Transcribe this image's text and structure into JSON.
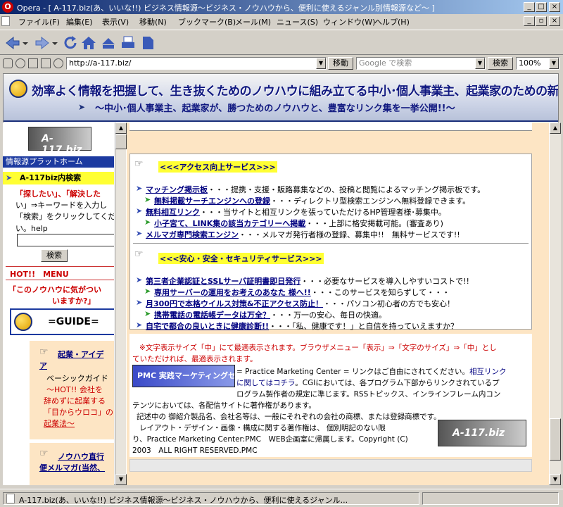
{
  "window": {
    "title": "Opera - [ A-117.biz(あ、いいな!!) ビジネス情報源〜ビジネス・ノウハウから、便利に使えるジャンル別情報源など〜 ]",
    "minimize": "_",
    "maximize": "□",
    "close": "×"
  },
  "menu": [
    "ファイル(F)",
    "編集(E)",
    "表示(V)",
    "移動(N)",
    "ブックマーク(B)",
    "メール(M)",
    "ニュース(S)",
    "ウィンドウ(W)",
    "ヘルプ(H)"
  ],
  "toolbar": {
    "icons": [
      "back-icon",
      "forward-icon",
      "reload-icon",
      "home-icon",
      "hotlist-icon",
      "print-icon",
      "page-icon"
    ]
  },
  "address": {
    "url": "http://a-117.biz/",
    "go_label": "移動",
    "search_placeholder": "Google で検索",
    "search_label": "検索",
    "zoom": "100%"
  },
  "banner": {
    "title": "効率よく情報を把握して、生き抜くためのノウハウに組み立てる中小･個人事業主、起業家のための新･情報入手ガイド",
    "subtitle": "〜中小･個人事業主、起業家が、勝つためのノウハウと、豊富なリンク集を一挙公開!!〜"
  },
  "left": {
    "logo": "A-117.biz",
    "platform": "情報源プラットホーム",
    "search_title": "A-117biz内検索",
    "search_text1": "「探したい」、「解決した",
    "search_text2": "い」⇒キーワードを入力し",
    "search_text3": "「検索」をクリックしてくだ",
    "search_example": "い。help",
    "search_button": "検索",
    "hot_menu": "HOT!!　MENU",
    "notice1": "「このノウハウに気がつい",
    "notice2": "いますか?」",
    "guide": "=GUIDE=",
    "item1_title": "起業・アイデ",
    "item1_title2": "ア",
    "item1_l1": "ベーシックガイド",
    "item1_l2": "〜HOT!! 会社を",
    "item1_l3": "辞めずに起業する",
    "item1_l4": "「目からウロコ」の",
    "item1_l5": "起業法〜",
    "item2_title": "ノウハウ直行",
    "item2_l1": "便メルマガ(当然、"
  },
  "main": {
    "section1_title": "<<<アクセス向上サービス>>>",
    "s1": [
      {
        "link": "マッチング掲示板",
        "desc": "・・・提携・支援・販路募集などの、投稿と閲覧によるマッチング掲示板です。"
      },
      {
        "link": "無料掲載サーチエンジンへの登録",
        "desc": "・・・ディレクトリ型検索エンジンへ無料登録できます。"
      },
      {
        "link": "無料相互リンク",
        "desc": "・・・当サイトと相互リンクを張っていただけるHP管理者様･募集中。"
      },
      {
        "link": "小子宮て、LINK集の該当カテゴリーへ掲載",
        "desc": "・・・上部に格安掲載可能。(審査あり)"
      },
      {
        "link": "メルマガ専門検索エンジン",
        "desc": "・・・メルマガ発行者様の登録、募集中!!　無料サービスです!!"
      }
    ],
    "section2_title": "<<<安心・安全・セキュリティサービス>>>",
    "s2": [
      {
        "link": "第三者企業認証とSSLサーバ証明書即日発行",
        "desc": "・・・必要なサービスを導入しやすいコストで!!"
      },
      {
        "link": "専用サーバーの運用をお考えのあなた 様へ!!",
        "desc": "・・・このサービスを知らずして・・・"
      },
      {
        "link": "月300円で本格ウイルス対策&不正アクセス防止！",
        "desc": "・・・パソコン初心者の方でも安心！"
      },
      {
        "link": "携帯電話の電話帳データは万全？",
        "desc": "・・・万一の安心、毎日の快適。"
      },
      {
        "link": "自宅で都合の良いときに健康診断!!",
        "desc": "・・・「私、健康です！」と自信を持っていえますか？"
      }
    ],
    "footer_notice1": "※文字表示サイズ「中」にて最適表示されます。ブラウザメニュー「表示」⇒「文字のサイズ」⇒「中」とし",
    "footer_notice2": "ていただければ、最適表示されます。",
    "pmc_logo": "PMC 実践マーケティングセンター",
    "copy1": "= Practice Marketing Center = リンクはご自由にされてください。",
    "copy1_link": "相互リンク",
    "copy2_link": "に関してはコチラ",
    "copy2": "。CGIにおいては、各プログラム下部からリンクされているプ",
    "copy3": "ログラム製作者の規定に準じます。RSSトピックス、インラインフレーム内コン",
    "copy4": "テンツにおいては、各配信サイトに著作権があります。",
    "copy5": "記述中の 御紹介製品名、会社名等は、一般にそれぞれの会社の商標、または登録商標です。",
    "copy6": "レイアウト・デザイン・画像・構成に関する著作権は、 個別明記のない限",
    "copy7": "り、Practice Marketing Center:PMC　WEB企画室に帰属します。Copyright (C)",
    "copy8": "2003　ALL RIGHT RESERVED.PMC",
    "logo2": "A-117.biz"
  },
  "status": {
    "text": "A-117.biz(あ、いいな!!) ビジネス情報源〜ビジネス・ノウハウから、便利に使えるジャンル..."
  }
}
